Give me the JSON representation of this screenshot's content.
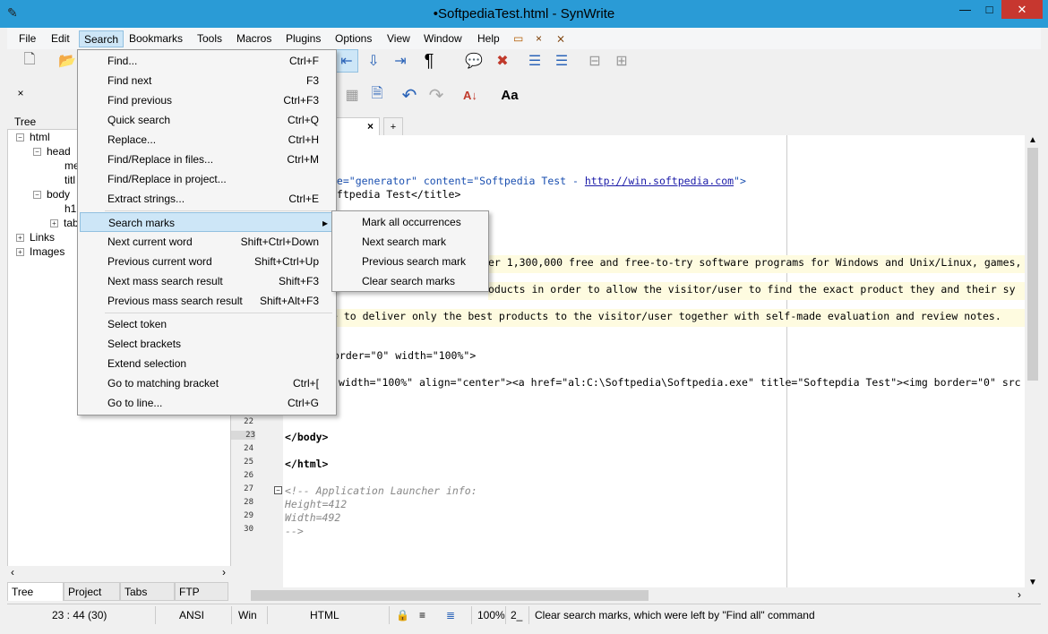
{
  "window": {
    "title": "•SoftpediaTest.html - SynWrite",
    "minimize": "—",
    "maximize": "□",
    "close": "✕"
  },
  "menubar": [
    "File",
    "Edit",
    "Search",
    "Bookmarks",
    "Tools",
    "Macros",
    "Plugins",
    "Options",
    "View",
    "Window",
    "Help"
  ],
  "search_menu": [
    {
      "label": "Find...",
      "shortcut": "Ctrl+F"
    },
    {
      "label": "Find next",
      "shortcut": "F3"
    },
    {
      "label": "Find previous",
      "shortcut": "Ctrl+F3"
    },
    {
      "label": "Quick search",
      "shortcut": "Ctrl+Q"
    },
    {
      "label": "Replace...",
      "shortcut": "Ctrl+H"
    },
    {
      "label": "Find/Replace in files...",
      "shortcut": "Ctrl+M"
    },
    {
      "label": "Find/Replace in project...",
      "shortcut": ""
    },
    {
      "label": "Extract strings...",
      "shortcut": "Ctrl+E"
    },
    {
      "label": "Search marks",
      "shortcut": "▸"
    },
    {
      "label": "Next current word",
      "shortcut": "Shift+Ctrl+Down"
    },
    {
      "label": "Previous current word",
      "shortcut": "Shift+Ctrl+Up"
    },
    {
      "label": "Next mass search result",
      "shortcut": "Shift+F3"
    },
    {
      "label": "Previous mass search result",
      "shortcut": "Shift+Alt+F3"
    },
    {
      "label": "Select token",
      "shortcut": ""
    },
    {
      "label": "Select brackets",
      "shortcut": ""
    },
    {
      "label": "Extend selection",
      "shortcut": ""
    },
    {
      "label": "Go to matching bracket",
      "shortcut": "Ctrl+["
    },
    {
      "label": "Go to line...",
      "shortcut": "Ctrl+G"
    }
  ],
  "search_marks_submenu": [
    "Mark all occurrences",
    "Next search mark",
    "Previous search mark",
    "Clear search marks"
  ],
  "left_panel": {
    "close": "×",
    "header": "Tree",
    "tree": [
      {
        "label": "html",
        "box": "−"
      },
      {
        "label": "head",
        "box": "−"
      },
      {
        "label": "me",
        "box": ""
      },
      {
        "label": "titl",
        "box": ""
      },
      {
        "label": "body",
        "box": "−"
      },
      {
        "label": "h1",
        "box": ""
      },
      {
        "label": "tab",
        "box": "+"
      },
      {
        "label": "Links",
        "box": "+"
      },
      {
        "label": "Images",
        "box": "+"
      }
    ],
    "tabs": [
      "Tree",
      "Project",
      "Tabs",
      "FTP"
    ]
  },
  "editor": {
    "tab_close": "×",
    "tab_add": "+",
    "lines": [
      {
        "n": "22",
        "t": ""
      },
      {
        "n": "23",
        "t": "</body>"
      },
      {
        "n": "24",
        "t": ""
      },
      {
        "n": "25",
        "t": "</html>"
      },
      {
        "n": "26",
        "t": ""
      },
      {
        "n": "27",
        "t": "<!-- Application Launcher info:"
      },
      {
        "n": "28",
        "t": "Height=412"
      },
      {
        "n": "29",
        "t": "Width=492"
      },
      {
        "n": "30",
        "t": "-->"
      }
    ],
    "visible_code": {
      "meta_name": "me=\"generator\" content=\"Softpedia Test - ",
      "meta_link": "http://win.softpedia.com",
      "meta_end": "\">",
      "title_line": "oftpedia Test</title>",
      "p1": "er 1,300,000 free and free-to-try software programs for Windows and Unix/Linux, games,",
      "p2": "oducts in order to allow the visitor/user to find the exact product they and their sy",
      "p3": "e to deliver only the best products to the visitor/user together with self-made evaluation and review notes.",
      "table": "order=\"0\" width=\"100%\">",
      "td": "width=\"100%\" align=\"center\"><a href=\"al:C:\\Softpedia\\Softpedia.exe\" title=\"Softepdia Test\"><img border=\"0\" src"
    }
  },
  "statusbar": {
    "position": "23 : 44 (30)",
    "encoding": "ANSI",
    "line_ending": "Win",
    "syntax": "HTML",
    "zoom": "100%",
    "extra": "2_",
    "message": "Clear search marks, which were left by \"Find all\" command"
  }
}
